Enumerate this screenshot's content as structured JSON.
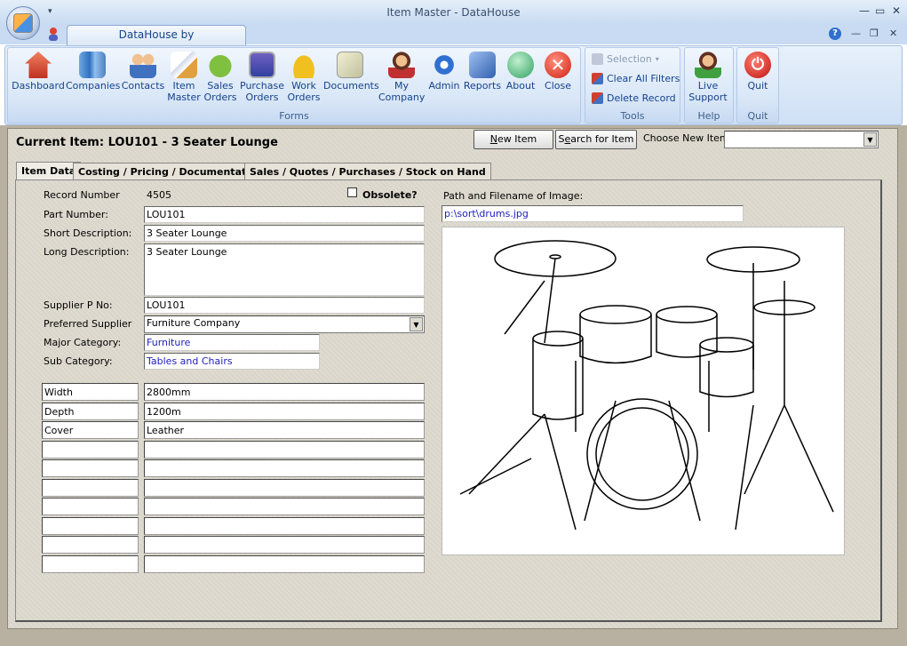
{
  "window": {
    "title": "Item Master - DataHouse",
    "app_tab": "DataHouse by DataHouseSoftware"
  },
  "ribbon": {
    "forms_label": "Forms",
    "tools_label": "Tools",
    "help_label": "Help",
    "quit_label": "Quit",
    "buttons": {
      "dashboard": "Dashboard",
      "companies": "Companies",
      "contacts": "Contacts",
      "item_master_1": "Item",
      "item_master_2": "Master",
      "sales_orders_1": "Sales",
      "sales_orders_2": "Orders",
      "purchase_orders_1": "Purchase",
      "purchase_orders_2": "Orders",
      "work_orders_1": "Work",
      "work_orders_2": "Orders",
      "documents": "Documents",
      "my_company_1": "My",
      "my_company_2": "Company",
      "admin": "Admin",
      "reports": "Reports",
      "about": "About",
      "close": "Close",
      "live_support_1": "Live",
      "live_support_2": "Support",
      "quit": "Quit"
    },
    "tools": {
      "selection": "Selection",
      "clear_filters": "Clear All Filters",
      "delete_record": "Delete Record"
    }
  },
  "header": {
    "current_item": "Current Item: LOU101 - 3 Seater Lounge",
    "new_item_pre": "",
    "new_item_u": "N",
    "new_item_post": "ew Item",
    "search_pre": "S",
    "search_u": "e",
    "search_post": "arch for Item",
    "choose_label": "Choose New Item",
    "choose_value": ""
  },
  "tabs": [
    "Item Data",
    "Costing / Pricing / Documentation",
    "Sales / Quotes / Purchases / Stock on Hand"
  ],
  "item": {
    "record_number_label": "Record Number",
    "record_number": "4505",
    "obsolete_label": "Obsolete?",
    "part_number_label": "Part Number:",
    "part_number": "LOU101",
    "short_desc_label": "Short Description:",
    "short_desc": "3 Seater Lounge",
    "long_desc_label": "Long Description:",
    "long_desc": "3 Seater Lounge",
    "supplier_pno_label": "Supplier P No:",
    "supplier_pno": "LOU101",
    "preferred_supplier_label": "Preferred Supplier",
    "preferred_supplier": "Furniture Company",
    "major_category_label": "Major Category:",
    "major_category": "Furniture",
    "sub_category_label": "Sub Category:",
    "sub_category": "Tables and Chairs",
    "image_path_label": "Path and Filename of Image:",
    "image_path": "p:\\sort\\drums.jpg"
  },
  "attributes": [
    {
      "name": "Width",
      "value": "2800mm"
    },
    {
      "name": "Depth",
      "value": "1200m"
    },
    {
      "name": "Cover",
      "value": "Leather"
    },
    {
      "name": "",
      "value": ""
    },
    {
      "name": "",
      "value": ""
    },
    {
      "name": "",
      "value": ""
    },
    {
      "name": "",
      "value": ""
    },
    {
      "name": "",
      "value": ""
    },
    {
      "name": "",
      "value": ""
    },
    {
      "name": "",
      "value": ""
    }
  ]
}
